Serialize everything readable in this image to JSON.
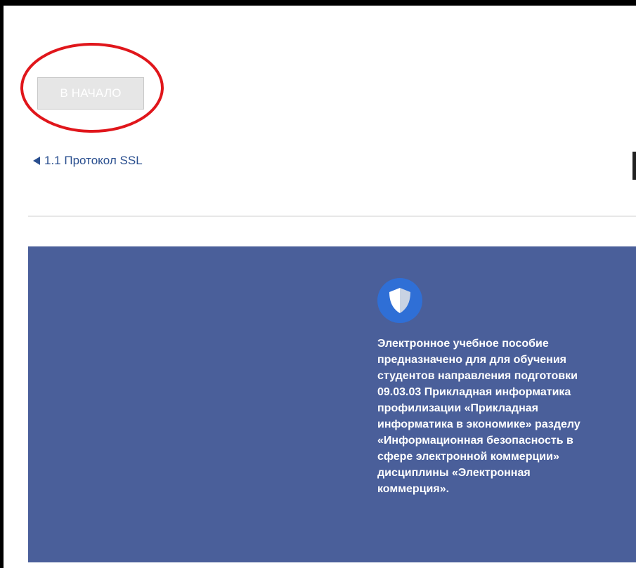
{
  "nav": {
    "home_button_label": "В НАЧАЛО",
    "prev_link_label": "1.1 Протокол SSL"
  },
  "footer": {
    "icon": "shield-icon",
    "description": "Электронное учебное пособие\nпредназначено для для обучения\nстудентов направления подготовки\n09.03.03 Прикладная информатика\nпрофилизации «Прикладная\nинформатика в экономике» разделу\n«Информационная безопасность в\nсфере электронной коммерции»\nдисциплины «Электронная\nкоммерция»."
  },
  "colors": {
    "footer_bg": "#4a5f9a",
    "link": "#2a4f8f",
    "annotation_ring": "#e0161b",
    "shield_circle": "#2f6fd6"
  }
}
